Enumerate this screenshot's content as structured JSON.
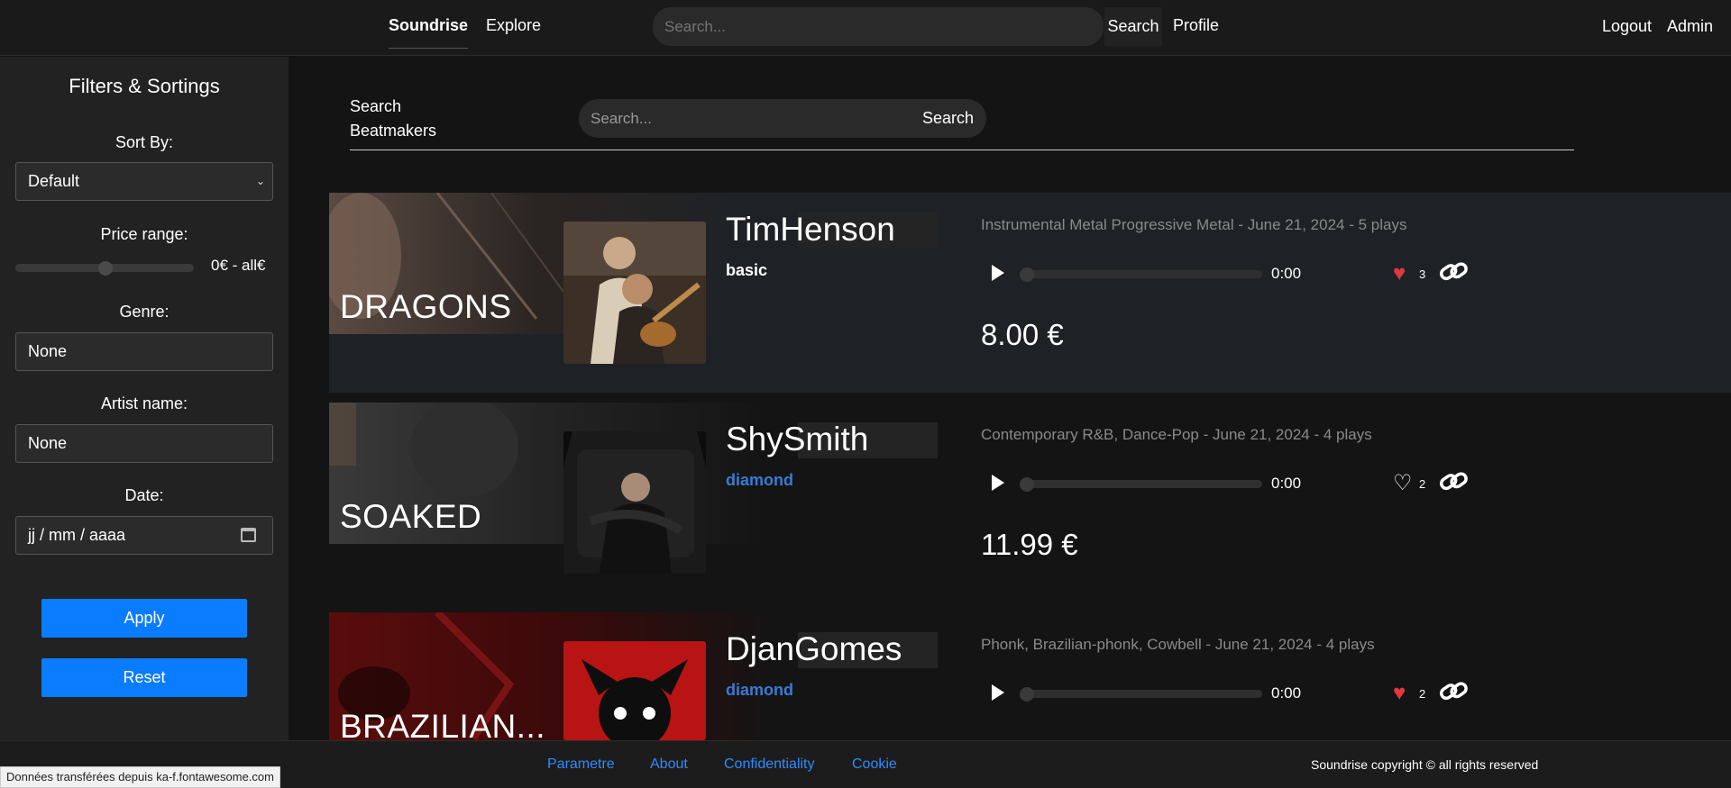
{
  "nav": {
    "brand": "Soundrise",
    "explore": "Explore",
    "search_placeholder": "Search...",
    "search_button": "Search",
    "profile": "Profile",
    "logout": "Logout",
    "admin": "Admin"
  },
  "sidebar": {
    "title": "Filters & Sortings",
    "sort_label": "Sort By:",
    "sort_value": "Default",
    "price_label": "Price range:",
    "price_value": "0€ -  all€",
    "price_slider_fraction": 0.5,
    "genre_label": "Genre:",
    "genre_value": "None",
    "artist_label": "Artist name:",
    "artist_value": "None",
    "date_label": "Date:",
    "date_placeholder": "jj / mm / aaaa",
    "apply": "Apply",
    "reset": "Reset"
  },
  "section": {
    "label_line1": "Search",
    "label_line2": "Beatmakers",
    "search_placeholder": "Search...",
    "search_button": "Search"
  },
  "beats": [
    {
      "cover_title": "DRAGONS",
      "artist": "TimHenson",
      "tier": "basic",
      "tier_color": "#ffffff",
      "meta": "Instrumental Metal Progressive Metal - June 21, 2024 - 5 plays",
      "time": "0:00",
      "likes": "3",
      "liked": true,
      "price": "8.00 €"
    },
    {
      "cover_title": "SOAKED",
      "artist": "ShySmith",
      "tier": "diamond",
      "tier_color": "#3a7bd5",
      "meta": "Contemporary R&B, Dance-Pop - June 21, 2024 - 4 plays",
      "time": "0:00",
      "likes": "2",
      "liked": false,
      "price": "11.99 €"
    },
    {
      "cover_title": "BRAZILIAN...",
      "artist": "DjanGomes",
      "tier": "diamond",
      "tier_color": "#3a7bd5",
      "meta": "Phonk, Brazilian-phonk, Cowbell - June 21, 2024 - 4 plays",
      "time": "0:00",
      "likes": "2",
      "liked": true,
      "price": ""
    }
  ],
  "footer": {
    "links": [
      "Parametre",
      "About",
      "Confidentiality",
      "Cookie"
    ],
    "copyright": "Soundrise copyright © all rights reserved"
  },
  "status_bar": "Données transférées depuis ka-f.fontawesome.com",
  "colors": {
    "accent": "#0a7cff",
    "heart": "#e0393e",
    "diamond": "#3a7bd5"
  }
}
